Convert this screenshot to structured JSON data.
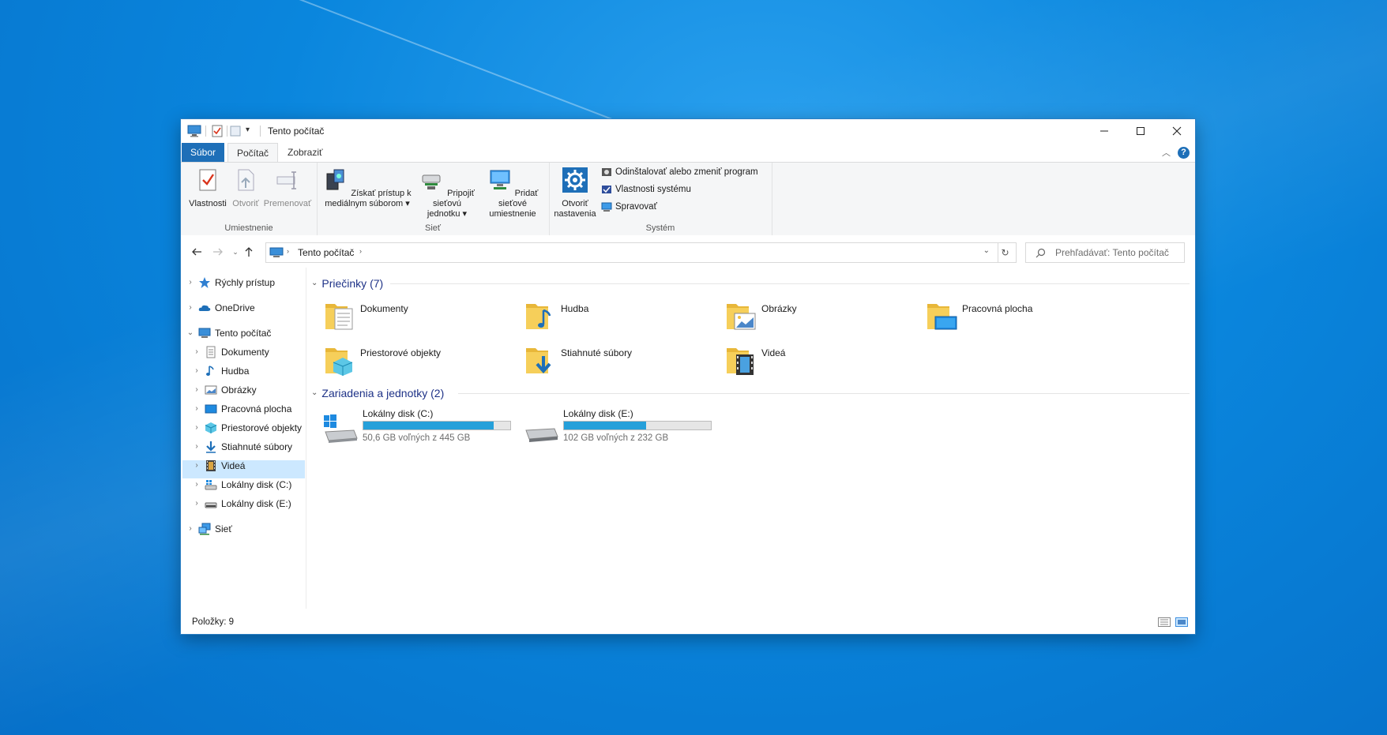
{
  "window": {
    "title": "Tento počítač",
    "tabs": {
      "file": "Súbor",
      "computer": "Počítač",
      "view": "Zobraziť"
    }
  },
  "ribbon": {
    "groups": {
      "location": "Umiestnenie",
      "network": "Sieť",
      "system": "Systém"
    },
    "properties": "Vlastnosti",
    "open": "Otvoriť",
    "rename": "Premenovať",
    "media_l1": "Získať prístup k",
    "media_l2": "mediálnym súborom",
    "map_l1": "Pripojiť sieťovú",
    "map_l2": "jednotku",
    "addnet_l1": "Pridať sieťové",
    "addnet_l2": "umiestnenie",
    "settings_l1": "Otvoriť",
    "settings_l2": "nastavenia",
    "uninstall": "Odinštalovať alebo zmeniť program",
    "sysprops": "Vlastnosti systému",
    "manage": "Spravovať"
  },
  "address": {
    "crumb": "Tento počítač",
    "search_placeholder": "Prehľadávať: Tento počítač"
  },
  "tree": {
    "quick": "Rýchly prístup",
    "onedrive": "OneDrive",
    "thispc": "Tento počítač",
    "documents": "Dokumenty",
    "music": "Hudba",
    "pictures": "Obrázky",
    "desktop": "Pracovná plocha",
    "objects3d": "Priestorové objekty",
    "downloads": "Stiahnuté súbory",
    "videos": "Videá",
    "diskc": "Lokálny disk (C:)",
    "diske": "Lokálny disk (E:)",
    "network": "Sieť"
  },
  "folders_header": "Priečinky (7)",
  "folders": {
    "documents": "Dokumenty",
    "music": "Hudba",
    "pictures": "Obrázky",
    "desktop": "Pracovná plocha",
    "objects3d": "Priestorové objekty",
    "downloads": "Stiahnuté súbory",
    "videos": "Videá"
  },
  "drives_header": "Zariadenia a jednotky (2)",
  "drives": {
    "c": {
      "name": "Lokálny disk (C:)",
      "free": "50,6 GB voľných z 445 GB",
      "used_fraction": 0.886
    },
    "e": {
      "name": "Lokálny disk (E:)",
      "free": "102 GB voľných z 232 GB",
      "used_fraction": 0.56
    }
  },
  "status": {
    "items": "Položky: 9"
  },
  "colors": {
    "accent": "#1e6fb8",
    "selection": "#cce8ff",
    "header_text": "#1e3287",
    "bar_fill": "#26a0da"
  }
}
